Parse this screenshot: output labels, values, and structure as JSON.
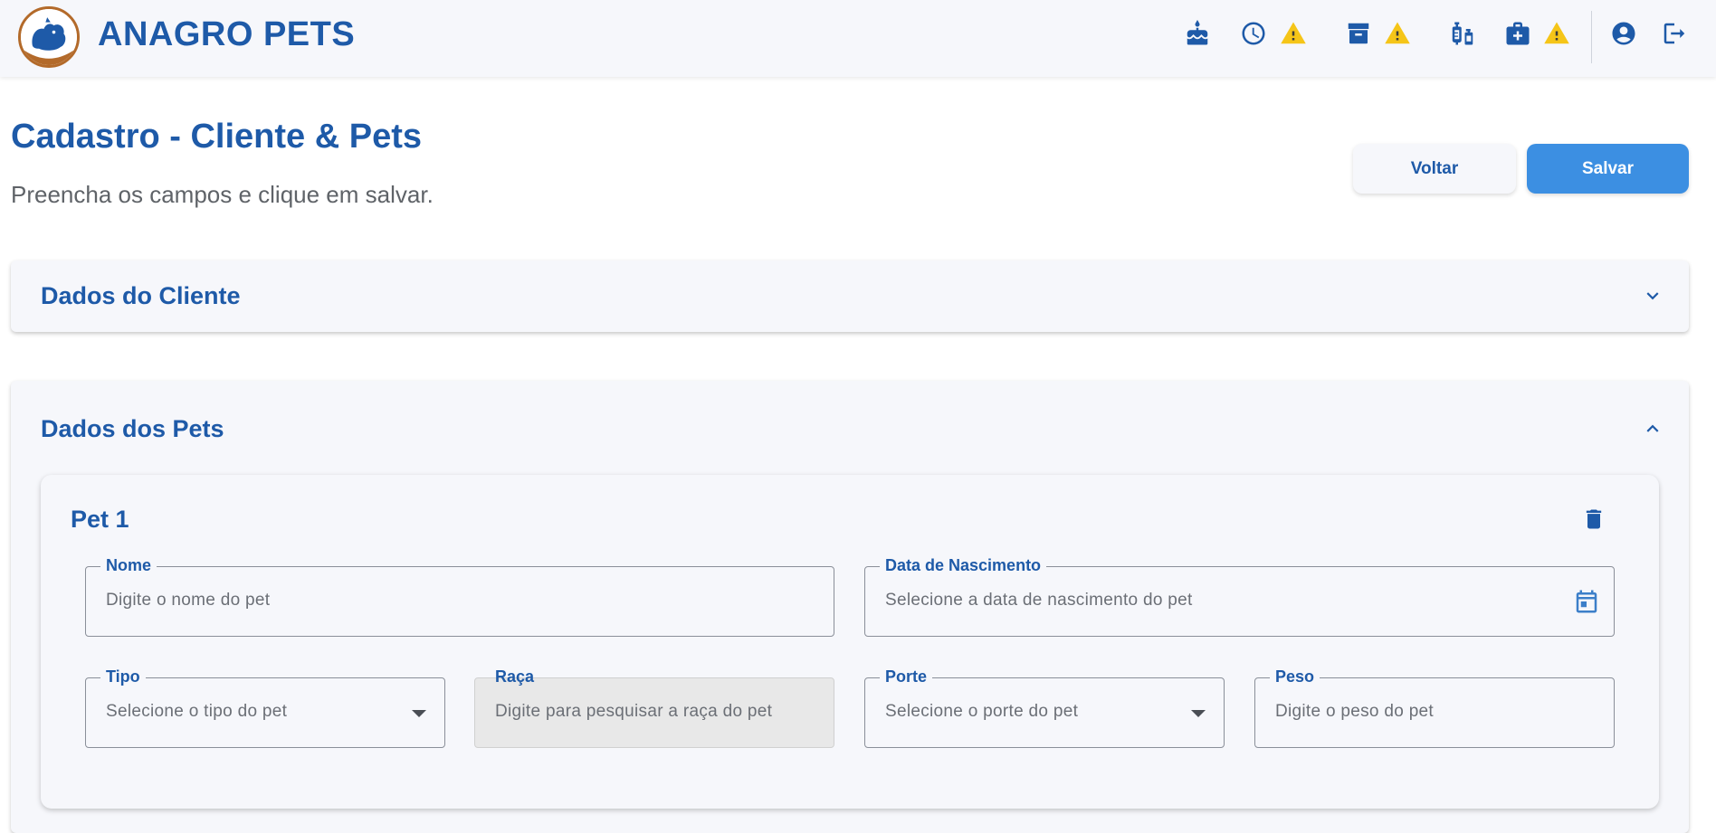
{
  "header": {
    "app_title": "ANAGRO PETS",
    "icons": [
      "cake-icon",
      "clock-icon",
      "warning-icon",
      "archive-icon",
      "warning-icon",
      "vaccine-icon",
      "medical-kit-icon",
      "warning-icon",
      "account-icon",
      "logout-icon"
    ]
  },
  "page": {
    "title": "Cadastro - Cliente & Pets",
    "subtitle": "Preencha os campos e clique em salvar."
  },
  "actions": {
    "back_label": "Voltar",
    "save_label": "Salvar"
  },
  "client_section": {
    "title": "Dados do Cliente"
  },
  "pets_section": {
    "title": "Dados dos Pets",
    "pets": [
      {
        "title": "Pet 1",
        "fields": {
          "name": {
            "label": "Nome",
            "placeholder": "Digite o nome do pet"
          },
          "birth_date": {
            "label": "Data de Nascimento",
            "placeholder": "Selecione a data de nascimento do pet"
          },
          "type": {
            "label": "Tipo",
            "placeholder": "Selecione o tipo do pet"
          },
          "breed": {
            "label": "Raça",
            "placeholder": "Digite para pesquisar a raça do pet"
          },
          "size": {
            "label": "Porte",
            "placeholder": "Selecione o porte do pet"
          },
          "weight": {
            "label": "Peso",
            "placeholder": "Digite o peso do pet"
          }
        }
      }
    ]
  },
  "colors": {
    "primary": "#1e5aa8",
    "accent": "#3c8fe2",
    "warning": "#f5c518",
    "background": "#f6f7fb"
  }
}
